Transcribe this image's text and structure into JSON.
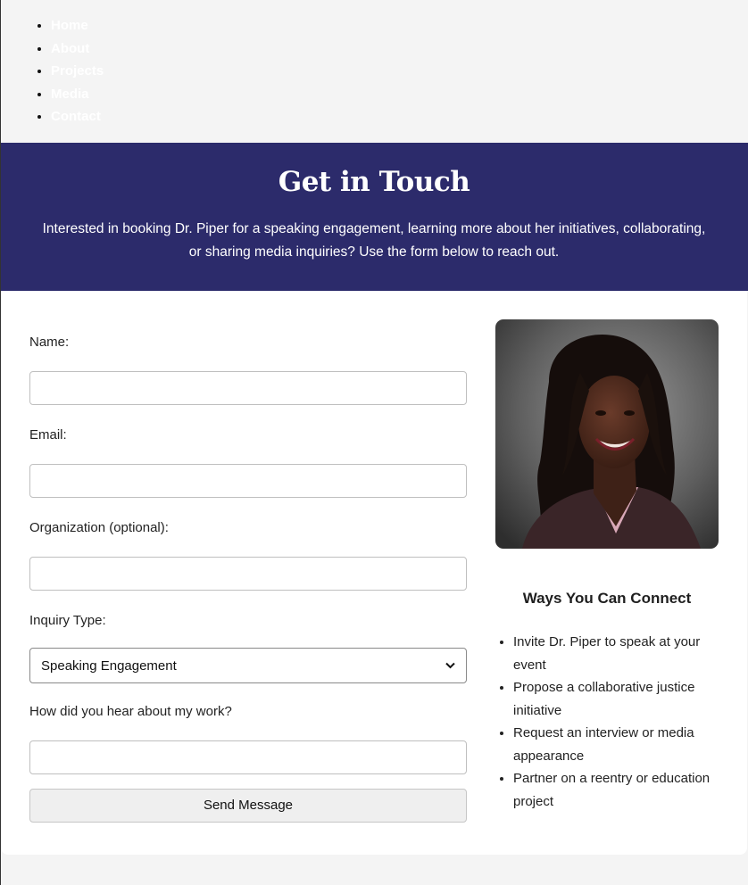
{
  "nav": {
    "items": [
      {
        "label": "Home"
      },
      {
        "label": "About"
      },
      {
        "label": "Projects"
      },
      {
        "label": "Media"
      },
      {
        "label": "Contact"
      }
    ]
  },
  "hero": {
    "title": "Get in Touch",
    "subtitle": "Interested in booking Dr. Piper for a speaking engagement, learning more about her initiatives, collaborating, or sharing media inquiries? Use the form below to reach out.",
    "background_color": "#2c2b6b"
  },
  "form": {
    "name_label": "Name:",
    "name_value": "",
    "email_label": "Email:",
    "email_value": "",
    "organization_label": "Organization (optional):",
    "organization_value": "",
    "inquiry_label": "Inquiry Type:",
    "inquiry_selected": "Speaking Engagement",
    "referral_label": "How did you hear about my work?",
    "referral_value": "",
    "submit_label": "Send Message"
  },
  "sidebar": {
    "heading": "Ways You Can Connect",
    "items": [
      {
        "text": "Invite Dr. Piper to speak at your event"
      },
      {
        "text": "Propose a collaborative justice initiative"
      },
      {
        "text": "Request an interview or media appearance"
      },
      {
        "text": "Partner on a reentry or education project"
      }
    ]
  }
}
